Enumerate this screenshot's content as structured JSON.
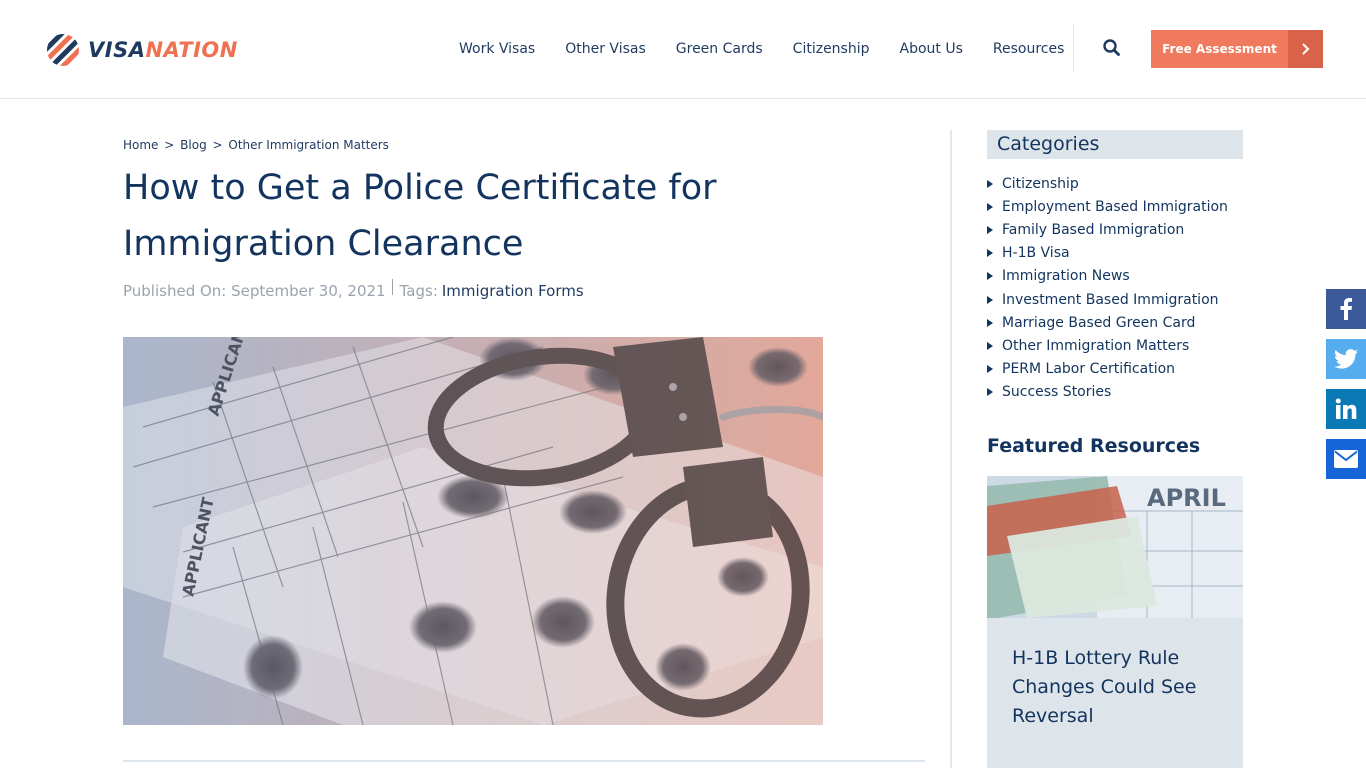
{
  "header": {
    "logo": {
      "part1": "VISA",
      "part2": "NATION"
    },
    "nav": [
      "Work Visas",
      "Other Visas",
      "Green Cards",
      "Citizenship",
      "About Us",
      "Resources"
    ],
    "search_icon": "search-icon",
    "cta_label": "Free Assessment"
  },
  "colors": {
    "brand_navy": "#12345e",
    "brand_orange": "#f07a5d",
    "sidebar_bg": "#dde4ea"
  },
  "breadcrumb": {
    "home": "Home",
    "sep1": ">",
    "blog": "Blog",
    "sep2": ">",
    "current": "Other Immigration Matters"
  },
  "article": {
    "title": "How to Get a Police Certificate for Immigration Clearance",
    "published_label": "Published On: September 30, 2021",
    "tags_label": "Tags:",
    "tag": "Immigration Forms"
  },
  "sidebar": {
    "categories_title": "Categories",
    "categories": [
      "Citizenship",
      "Employment Based Immigration",
      "Family Based Immigration",
      "H-1B Visa",
      "Immigration News",
      "Investment Based Immigration",
      "Marriage Based Green Card",
      "Other Immigration Matters",
      "PERM Labor Certification",
      "Success Stories"
    ],
    "featured_title": "Featured Resources",
    "featured": {
      "image_text": "APRIL",
      "title": "H-1B Lottery Rule Changes Could See Reversal"
    }
  },
  "social": [
    "facebook-icon",
    "twitter-icon",
    "linkedin-icon",
    "email-icon"
  ]
}
